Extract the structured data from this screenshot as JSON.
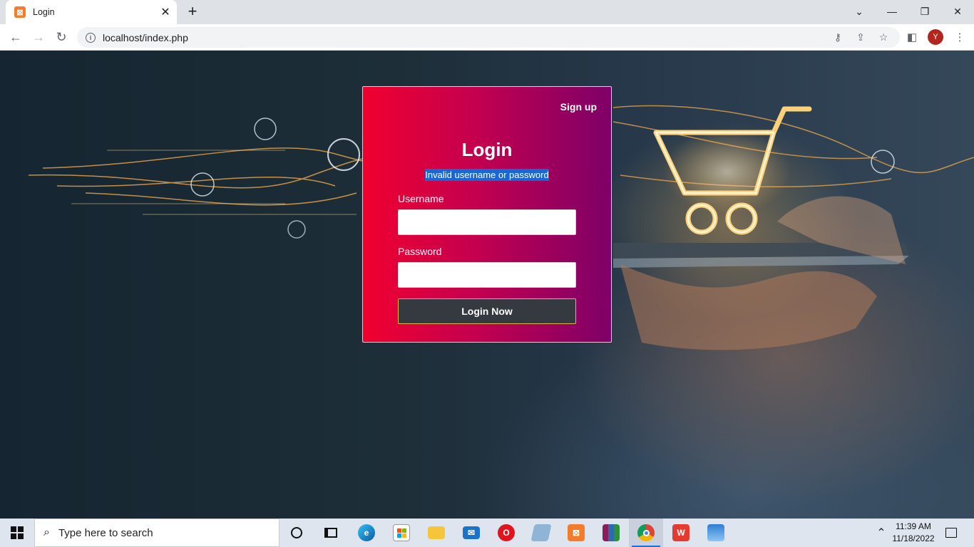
{
  "browser": {
    "tab_title": "Login",
    "tab_favicon": "xampp-icon",
    "url": "localhost/index.php"
  },
  "page": {
    "signup_link": "Sign up",
    "title": "Login",
    "error_message": "Invalid username or password",
    "username_label": "Username",
    "username_value": "",
    "password_label": "Password",
    "password_value": "",
    "submit_label": "Login Now"
  },
  "colors": {
    "card_gradient_start": "#f0002f",
    "card_gradient_end": "#7d0068",
    "button_bg": "#343a40",
    "button_border": "#e0b84a",
    "selection_highlight": "#1967d2"
  },
  "taskbar": {
    "search_placeholder": "Type here to search",
    "time": "11:39 AM",
    "date": "11/18/2022",
    "apps": [
      "cortana-icon",
      "task-view-icon",
      "edge-icon",
      "store-icon",
      "file-explorer-icon",
      "mail-icon",
      "opera-icon",
      "notepad-icon",
      "xampp-icon",
      "winrar-icon",
      "chrome-icon",
      "wps-icon",
      "photos-icon"
    ]
  },
  "profile_initial": "Y"
}
